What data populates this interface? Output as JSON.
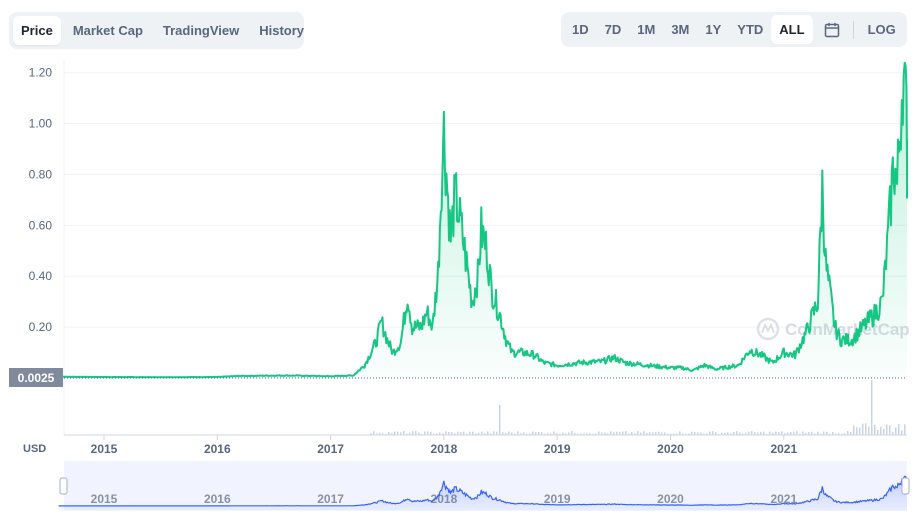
{
  "tabs": [
    "Price",
    "Market Cap",
    "TradingView",
    "History"
  ],
  "ranges": [
    "1D",
    "7D",
    "1M",
    "3M",
    "1Y",
    "YTD",
    "ALL"
  ],
  "log_label": "LOG",
  "currency": "USD",
  "current_price_label": "0.0025",
  "watermark": "CoinMarketCap",
  "icons": {
    "calendar": "calendar-icon",
    "watermark_logo": "coinmarketcap-logo-icon"
  },
  "colors": {
    "price_line": "#16c784",
    "nav_line": "#3861fb",
    "axis_text": "#58667e"
  },
  "chart_data": {
    "type": "area",
    "title": "",
    "xlabel": "",
    "ylabel": "",
    "y_ticks": [
      "0.20",
      "0.40",
      "0.60",
      "0.80",
      "1.00",
      "1.20"
    ],
    "x_ticks": [
      "2015",
      "2016",
      "2017",
      "2018",
      "2019",
      "2020",
      "2021"
    ],
    "ylim": [
      0,
      1.25
    ],
    "grid": true,
    "series": [
      {
        "values": [
          [
            2014.6,
            0.005
          ],
          [
            2015.0,
            0.004
          ],
          [
            2015.5,
            0.003
          ],
          [
            2016.0,
            0.004
          ],
          [
            2016.2,
            0.008
          ],
          [
            2016.6,
            0.01
          ],
          [
            2017.0,
            0.007
          ],
          [
            2017.2,
            0.01
          ],
          [
            2017.3,
            0.05
          ],
          [
            2017.4,
            0.14
          ],
          [
            2017.45,
            0.22
          ],
          [
            2017.5,
            0.15
          ],
          [
            2017.55,
            0.1
          ],
          [
            2017.62,
            0.14
          ],
          [
            2017.68,
            0.33
          ],
          [
            2017.72,
            0.2
          ],
          [
            2017.8,
            0.2
          ],
          [
            2017.85,
            0.26
          ],
          [
            2017.9,
            0.2
          ],
          [
            2017.95,
            0.42
          ],
          [
            2017.98,
            0.8
          ],
          [
            2018.0,
            0.97
          ],
          [
            2018.03,
            0.75
          ],
          [
            2018.06,
            0.55
          ],
          [
            2018.1,
            0.72
          ],
          [
            2018.15,
            0.6
          ],
          [
            2018.2,
            0.45
          ],
          [
            2018.25,
            0.3
          ],
          [
            2018.3,
            0.4
          ],
          [
            2018.33,
            0.58
          ],
          [
            2018.38,
            0.5
          ],
          [
            2018.42,
            0.35
          ],
          [
            2018.5,
            0.24
          ],
          [
            2018.55,
            0.15
          ],
          [
            2018.6,
            0.1
          ],
          [
            2018.7,
            0.1
          ],
          [
            2018.8,
            0.09
          ],
          [
            2018.88,
            0.06
          ],
          [
            2019.0,
            0.05
          ],
          [
            2019.2,
            0.06
          ],
          [
            2019.4,
            0.065
          ],
          [
            2019.5,
            0.08
          ],
          [
            2019.6,
            0.06
          ],
          [
            2019.8,
            0.05
          ],
          [
            2020.0,
            0.04
          ],
          [
            2020.1,
            0.04
          ],
          [
            2020.2,
            0.03
          ],
          [
            2020.3,
            0.05
          ],
          [
            2020.4,
            0.035
          ],
          [
            2020.6,
            0.05
          ],
          [
            2020.7,
            0.11
          ],
          [
            2020.8,
            0.09
          ],
          [
            2020.9,
            0.06
          ],
          [
            2021.0,
            0.1
          ],
          [
            2021.1,
            0.09
          ],
          [
            2021.2,
            0.18
          ],
          [
            2021.3,
            0.3
          ],
          [
            2021.34,
            0.75
          ],
          [
            2021.37,
            0.45
          ],
          [
            2021.45,
            0.2
          ],
          [
            2021.5,
            0.15
          ],
          [
            2021.6,
            0.15
          ],
          [
            2021.7,
            0.2
          ],
          [
            2021.8,
            0.25
          ],
          [
            2021.87,
            0.3
          ],
          [
            2021.92,
            0.55
          ],
          [
            2021.97,
            0.85
          ],
          [
            2022.0,
            0.75
          ],
          [
            2022.05,
            1.2
          ],
          [
            2022.1,
            0.95
          ],
          [
            2022.15,
            0.78
          ]
        ]
      }
    ]
  }
}
